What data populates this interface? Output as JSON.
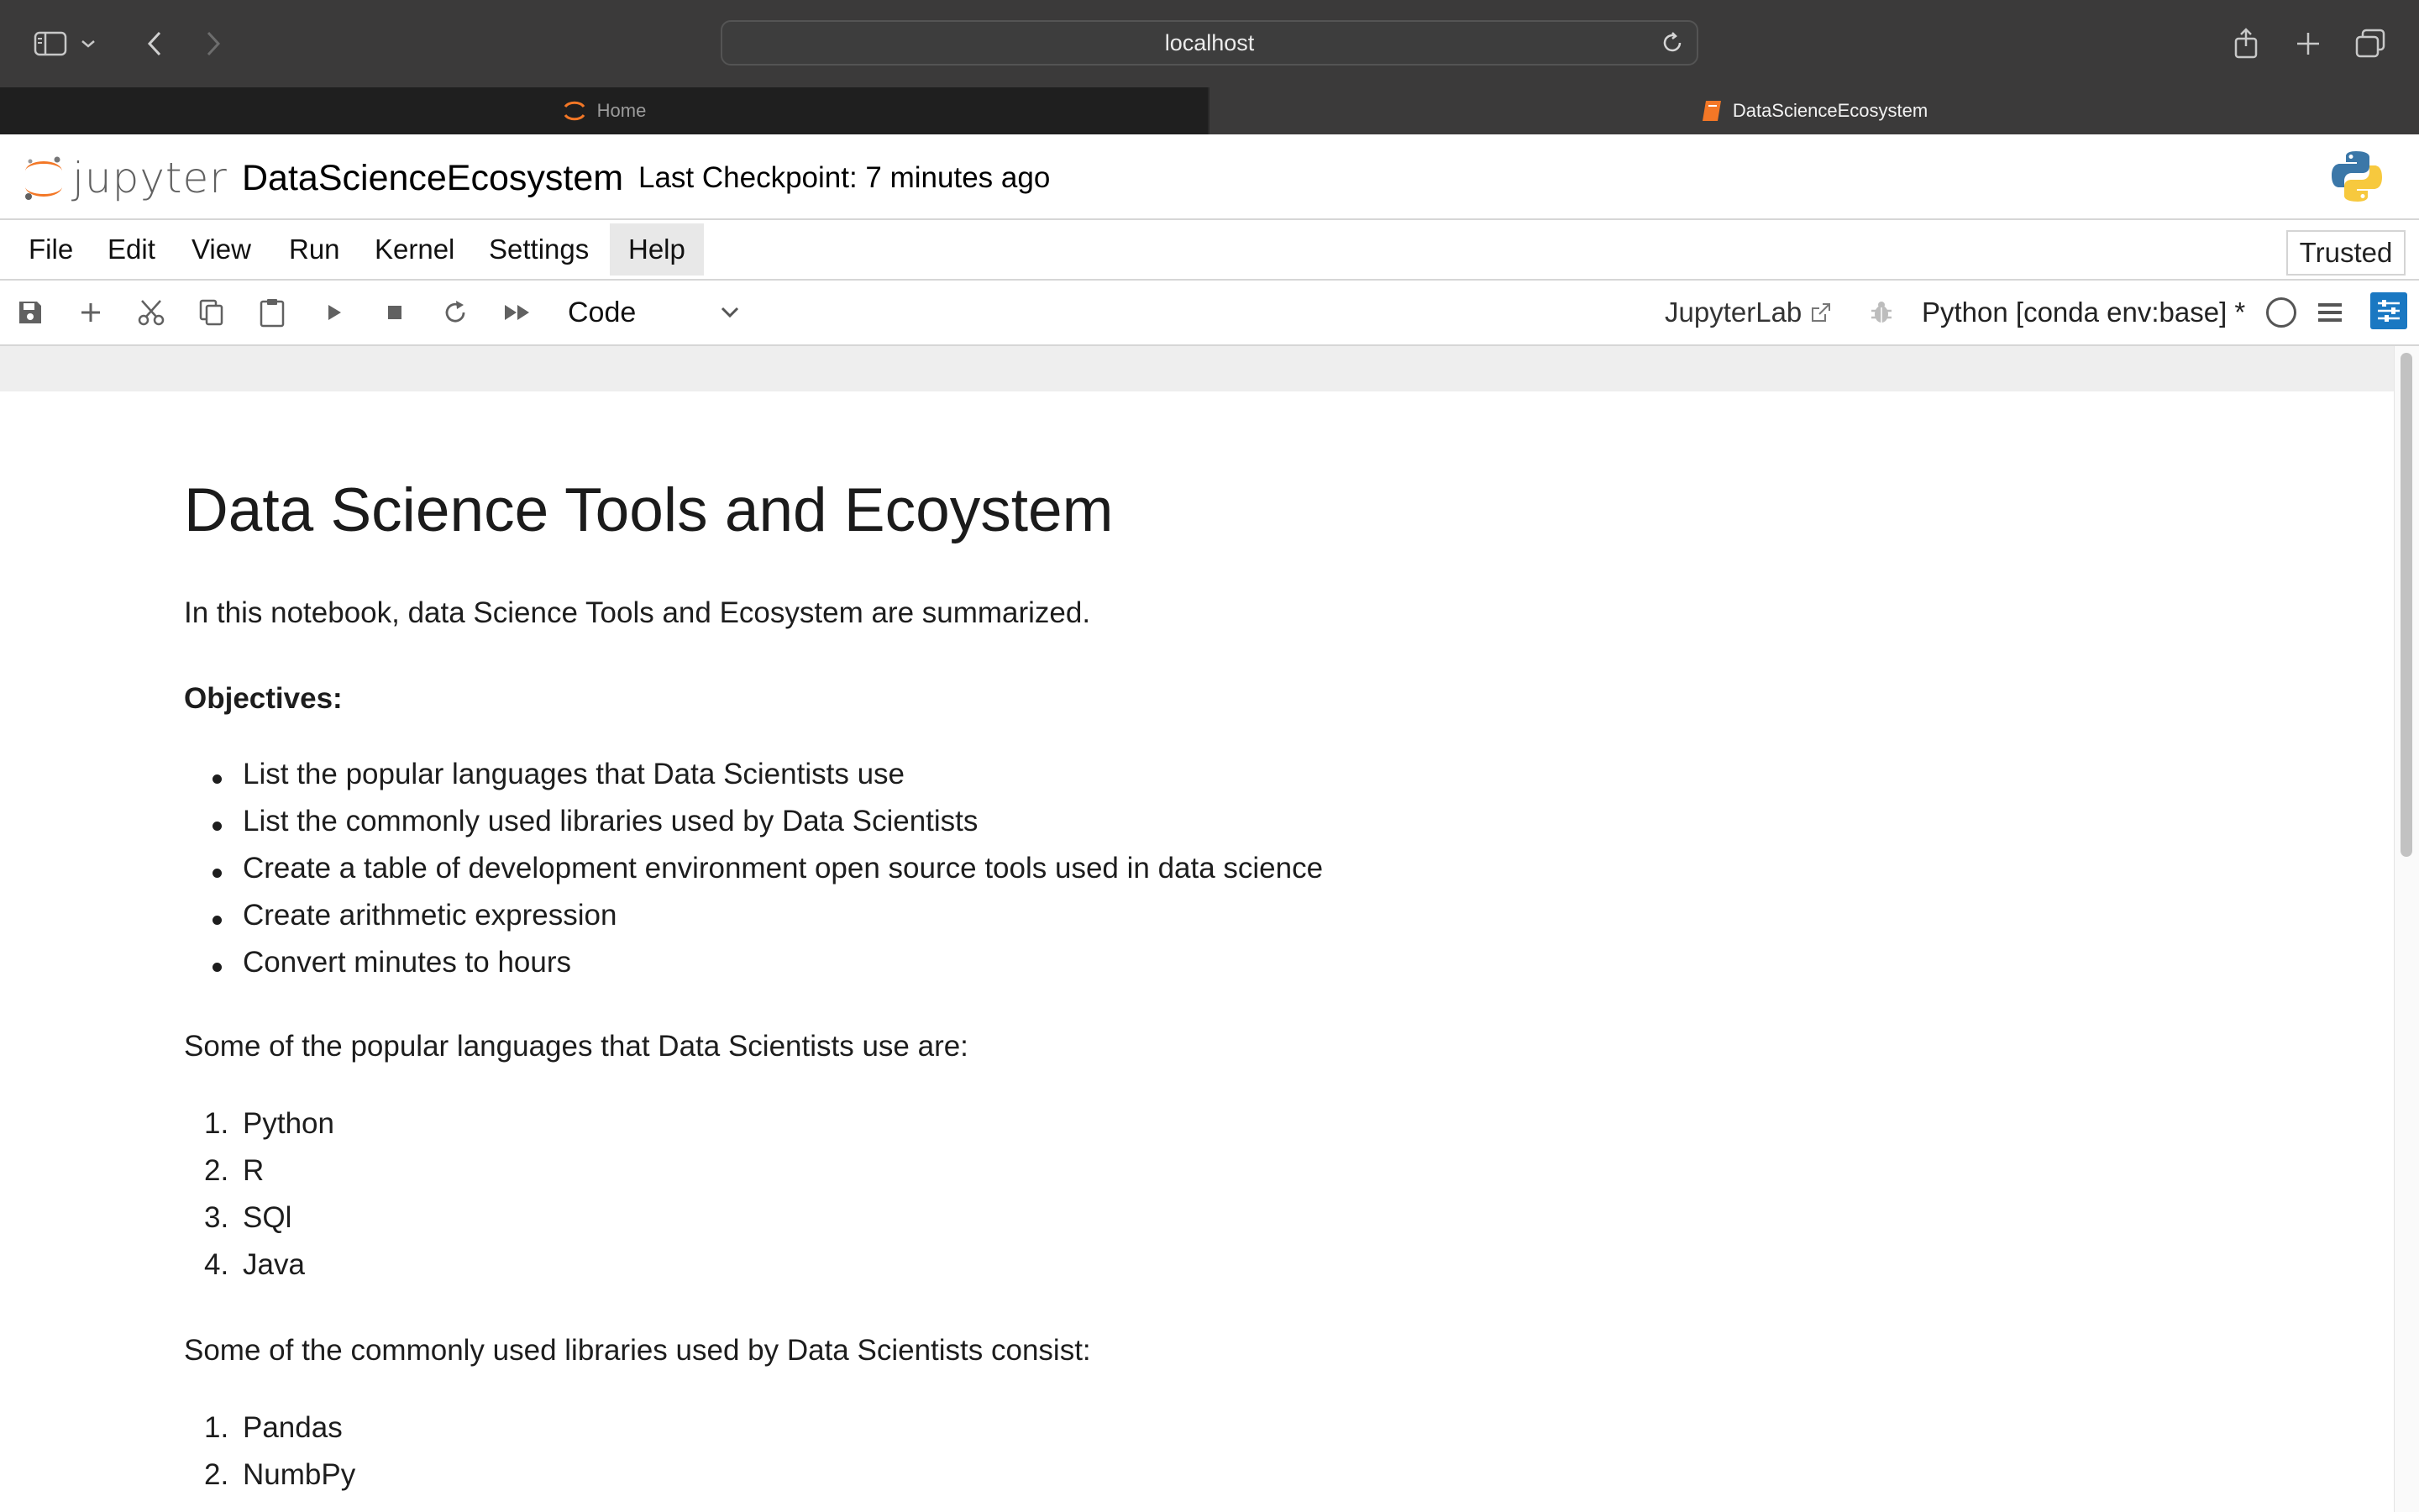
{
  "browser": {
    "url": "localhost",
    "tabs": [
      {
        "label": "Home",
        "active": false
      },
      {
        "label": "DataScienceEcosystem",
        "active": true
      }
    ]
  },
  "header": {
    "logo_text": "jupyter",
    "notebook_title": "DataScienceEcosystem",
    "checkpoint": "Last Checkpoint: 7 minutes ago"
  },
  "menu": {
    "items": [
      "File",
      "Edit",
      "View",
      "Run",
      "Kernel",
      "Settings",
      "Help"
    ],
    "open_item": "Help",
    "trusted_label": "Trusted"
  },
  "toolbar": {
    "cell_type": "Code",
    "jupyterlab_label": "JupyterLab",
    "kernel": "Python [conda env:base] *"
  },
  "notebook": {
    "heading": "Data Science Tools and Ecoystem",
    "intro": "In this notebook, data Science Tools and Ecosystem are summarized.",
    "objectives_label": "Objectives:",
    "objectives": [
      "List the popular languages that Data Scientists use",
      "List the commonly used libraries used by Data Scientists",
      "Create a table of development environment open source tools used in data science",
      "Create arithmetic expression",
      "Convert minutes to hours"
    ],
    "languages_intro": "Some of the popular languages that Data Scientists use are:",
    "languages": [
      {
        "num": "1.",
        "name": "Python"
      },
      {
        "num": "2.",
        "name": "R"
      },
      {
        "num": "3.",
        "name": "SQl"
      },
      {
        "num": "4.",
        "name": "Java"
      }
    ],
    "libraries_intro": "Some of the commonly used libraries used by Data Scientists consist:",
    "libraries": [
      {
        "num": "1.",
        "name": "Pandas"
      },
      {
        "num": "2.",
        "name": "NumbPy"
      }
    ]
  },
  "colors": {
    "jupyter_orange": "#f37726",
    "accent_blue": "#1a78c2",
    "browser_chrome": "#3b3a3a"
  }
}
